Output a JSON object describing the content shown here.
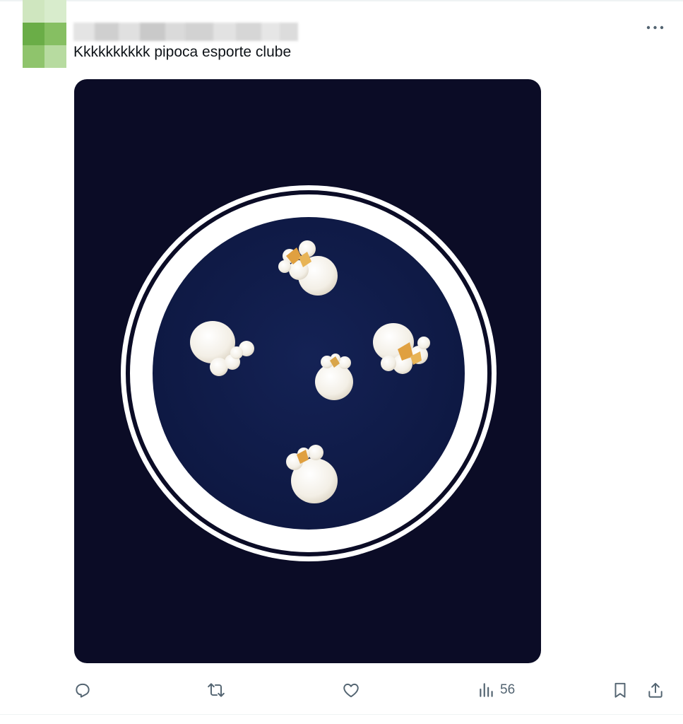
{
  "post": {
    "text": "Kkkkkkkkkk pipoca esporte clube",
    "image_alt": "pipoca esporte clube"
  },
  "actions": {
    "views_count": "56"
  },
  "colors": {
    "text_primary": "#0f1419",
    "icon_gray": "#536471",
    "media_background": "#0b0c26",
    "badge_inner": "#0f1a45",
    "badge_ring": "#ffffff"
  },
  "icons": [
    "more-icon",
    "reply-icon",
    "repost-icon",
    "like-icon",
    "views-icon",
    "bookmark-icon",
    "share-icon"
  ]
}
